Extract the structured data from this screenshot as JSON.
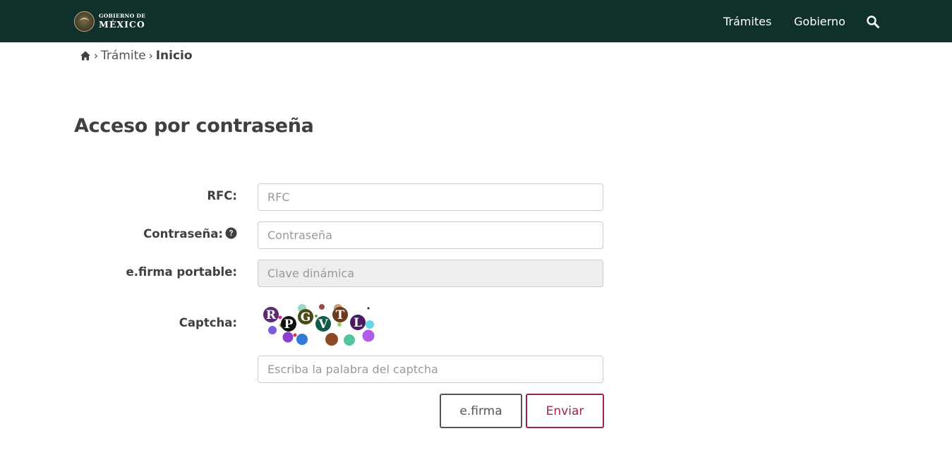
{
  "header": {
    "logo": {
      "line1": "GOBIERNO DE",
      "line2": "MÉXICO"
    },
    "nav": {
      "tramites": "Trámites",
      "gobierno": "Gobierno"
    },
    "icons": {
      "search": "search-icon",
      "seal": "mexico-seal-icon"
    }
  },
  "breadcrumb": {
    "home_icon": "home-icon",
    "items": [
      "Trámite",
      "Inicio"
    ],
    "separator": "›"
  },
  "page": {
    "title": "Acceso por contraseña"
  },
  "form": {
    "rfc": {
      "label": "RFC:",
      "placeholder": "RFC",
      "value": ""
    },
    "password": {
      "label": "Contraseña:",
      "placeholder": "Contraseña",
      "value": "",
      "help_icon": "question-circle-icon"
    },
    "efirma_portable": {
      "label": "e.firma portable:",
      "placeholder": "Clave dinámica",
      "value": "",
      "disabled": true
    },
    "captcha": {
      "label": "Captcha:",
      "image_text": "RPGVTL",
      "placeholder": "Escriba la palabra del captcha",
      "value": ""
    }
  },
  "buttons": {
    "efirma": "e.firma",
    "enviar": "Enviar"
  },
  "colors": {
    "header_bg": "#10312b",
    "primary": "#9d2449",
    "text": "#404041",
    "gold": "#bfa779"
  }
}
